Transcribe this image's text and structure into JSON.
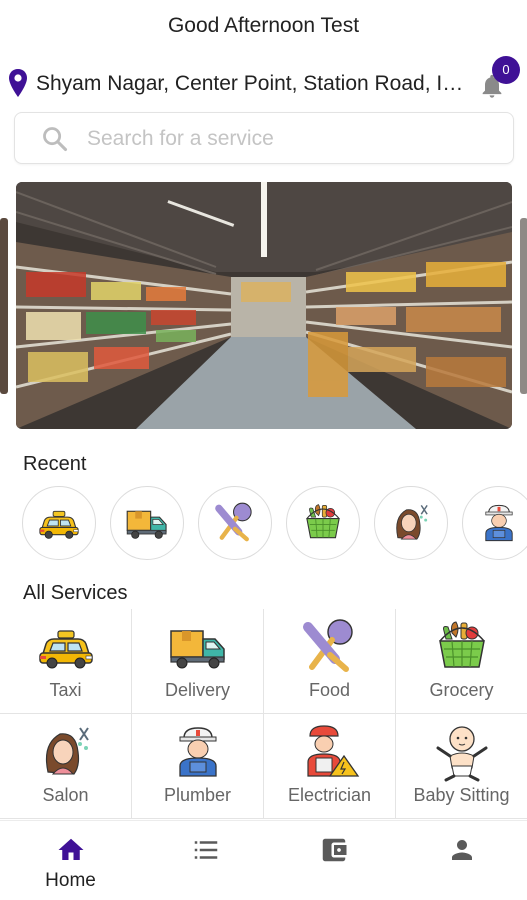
{
  "header": {
    "title": "Good Afternoon Test"
  },
  "location": {
    "address": "Shyam Nagar, Center Point, Station Road, Indore",
    "icon": "location-pin-icon"
  },
  "notifications": {
    "count": "0",
    "icon": "bell-icon"
  },
  "search": {
    "placeholder": "Search for a service",
    "icon": "search-icon"
  },
  "banner": {
    "subject": "supermarket-aisle-photo"
  },
  "recent": {
    "title": "Recent",
    "items": [
      {
        "icon": "taxi-icon"
      },
      {
        "icon": "delivery-truck-icon"
      },
      {
        "icon": "food-icon"
      },
      {
        "icon": "grocery-basket-icon"
      },
      {
        "icon": "salon-icon"
      },
      {
        "icon": "plumber-icon"
      }
    ]
  },
  "services": {
    "title": "All Services",
    "items": [
      {
        "label": "Taxi",
        "icon": "taxi-icon"
      },
      {
        "label": "Delivery",
        "icon": "delivery-truck-icon"
      },
      {
        "label": "Food",
        "icon": "food-icon"
      },
      {
        "label": "Grocery",
        "icon": "grocery-basket-icon"
      },
      {
        "label": "Salon",
        "icon": "salon-icon"
      },
      {
        "label": "Plumber",
        "icon": "plumber-icon"
      },
      {
        "label": "Electrician",
        "icon": "electrician-icon"
      },
      {
        "label": "Baby Sitting",
        "icon": "baby-sitting-icon"
      }
    ]
  },
  "bottom_nav": {
    "items": [
      {
        "label": "Home",
        "icon": "home-icon",
        "active": true
      },
      {
        "label": "",
        "icon": "list-icon",
        "active": false
      },
      {
        "label": "",
        "icon": "wallet-icon",
        "active": false
      },
      {
        "label": "",
        "icon": "profile-icon",
        "active": false
      }
    ]
  },
  "colors": {
    "accent": "#3f1196",
    "text": "#222222",
    "muted": "#666666",
    "border": "#e4e4e4"
  }
}
